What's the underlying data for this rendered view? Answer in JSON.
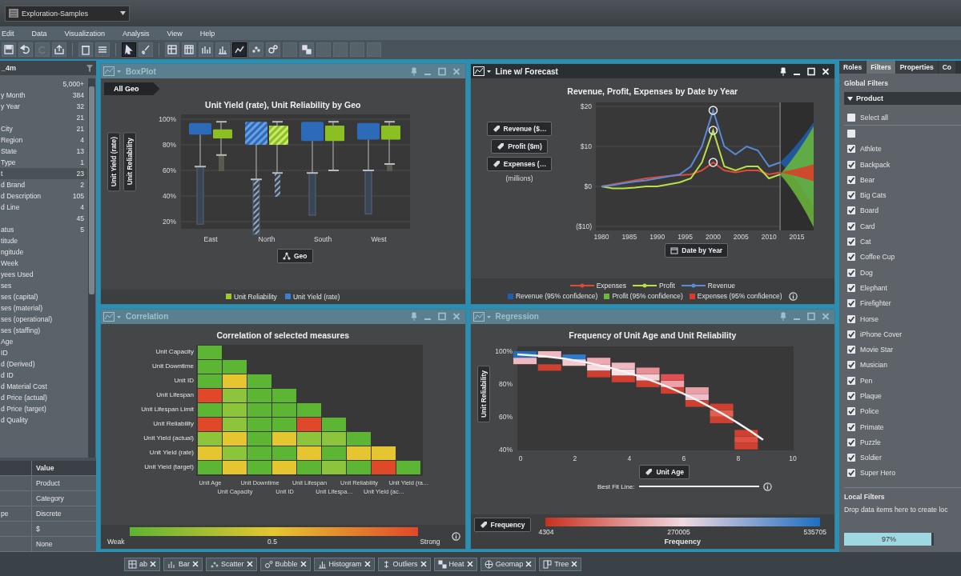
{
  "title_bar": {
    "document": "Exploration-Samples"
  },
  "menu": [
    "Edit",
    "Data",
    "Visualization",
    "Analysis",
    "View",
    "Help"
  ],
  "toolbar": [
    {
      "kind": "save",
      "selected": false
    },
    {
      "kind": "undo",
      "selected": false
    },
    {
      "kind": "redo",
      "selected": false
    },
    {
      "kind": "export",
      "selected": false
    },
    {
      "kind": "delete",
      "selected": false
    },
    {
      "kind": "layers",
      "selected": false
    },
    {
      "kind": "pointer",
      "selected": true
    },
    {
      "kind": "brush",
      "selected": false
    },
    {
      "kind": "crosstab",
      "selected": false
    },
    {
      "kind": "table",
      "selected": false
    },
    {
      "kind": "bars",
      "selected": false
    },
    {
      "kind": "columns",
      "selected": false
    },
    {
      "kind": "line",
      "selected": true
    },
    {
      "kind": "scatter",
      "selected": false
    },
    {
      "kind": "bubble",
      "selected": false
    },
    {
      "kind": "blank",
      "selected": false
    },
    {
      "kind": "heat",
      "selected": false
    },
    {
      "kind": "blank",
      "selected": false
    },
    {
      "kind": "blank",
      "selected": false
    },
    {
      "kind": "blank",
      "selected": false
    },
    {
      "kind": "blank",
      "selected": false
    }
  ],
  "data_panel": {
    "title": "_4m",
    "items": [
      {
        "count": "5,000+",
        "selected": false
      },
      {
        "name": "y Month",
        "count": "384",
        "selected": false
      },
      {
        "name": "y Year",
        "count": "32",
        "selected": false
      },
      {
        "count": "21",
        "selected": false
      },
      {
        "name": "City",
        "count": "21",
        "selected": false
      },
      {
        "name": "Region",
        "count": "4",
        "selected": false
      },
      {
        "name": "State",
        "count": "13",
        "selected": false
      },
      {
        "name": "Type",
        "count": "1",
        "selected": false
      },
      {
        "name": "t",
        "count": "23",
        "selected": true
      },
      {
        "name": "d Brand",
        "count": "2",
        "selected": false
      },
      {
        "name": "d Description",
        "count": "105",
        "selected": false
      },
      {
        "name": "d Line",
        "count": "4",
        "selected": false
      },
      {
        "count": "45",
        "selected": false
      },
      {
        "name": "atus",
        "count": "5",
        "selected": false
      },
      {
        "name": "titude",
        "selected": false
      },
      {
        "name": "ngitude",
        "selected": false
      },
      {
        "name": "Week",
        "selected": false
      },
      {
        "name": "yees Used",
        "selected": false
      },
      {
        "name": "ses",
        "selected": false
      },
      {
        "name": "ses (capital)",
        "selected": false
      },
      {
        "name": "ses (material)",
        "selected": false
      },
      {
        "name": "ses (operational)",
        "selected": false
      },
      {
        "name": "ses (staffing)",
        "selected": false
      },
      {
        "name": "Age",
        "selected": false
      },
      {
        "name": "ID",
        "selected": false
      },
      {
        "name": "d (Derived)",
        "selected": false
      },
      {
        "name": "d ID",
        "selected": false
      },
      {
        "name": "d Material Cost",
        "selected": false
      },
      {
        "name": "d Price (actual)",
        "selected": false
      },
      {
        "name": "d Price (target)",
        "selected": false
      },
      {
        "name": "d Quality",
        "selected": false
      }
    ],
    "properties": {
      "value_header": "Value",
      "rows": [
        {
          "value": "Product"
        },
        {
          "value": "Category"
        },
        {
          "name": "pe",
          "value": "Discrete"
        },
        {
          "value": "$"
        },
        {
          "value": "None"
        }
      ]
    }
  },
  "boxplot_panel": {
    "title": "BoxPlot",
    "active": false,
    "breadcrumb": "All Geo",
    "chart_title": "Unit Yield (rate), Unit Reliability by Geo",
    "y_ticks": [
      "100%",
      "80%",
      "60%",
      "40%",
      "20%"
    ],
    "roles": [
      "Unit Yield (rate)",
      "Unit Reliability"
    ],
    "categories": [
      {
        "label": "East",
        "selected": false
      },
      {
        "label": "North",
        "selected": true
      },
      {
        "label": "South",
        "selected": false
      },
      {
        "label": "West",
        "selected": false
      }
    ],
    "x_role": "Geo",
    "legend": [
      {
        "label": "Unit Reliability",
        "color": "#9ccc2c"
      },
      {
        "label": "Unit Yield (rate)",
        "color": "#3a7fd0"
      }
    ]
  },
  "line_panel": {
    "title": "Line w/ Forecast",
    "active": true,
    "roles": [
      "Revenue ($…",
      "Profit ($m)",
      "Expenses (…"
    ],
    "unit_note": "(millions)",
    "x_role": "Date by Year",
    "chart_data": {
      "type": "line",
      "title": "Revenue, Profit, Expenses by Date by Year",
      "x": [
        1980,
        1982,
        1984,
        1986,
        1988,
        1990,
        1992,
        1994,
        1996,
        1998,
        2000,
        2002,
        2004,
        2006,
        2008,
        2010,
        2012
      ],
      "series": [
        {
          "name": "Expenses",
          "color": "#e04a3a",
          "values": [
            0,
            0.5,
            1,
            1.5,
            2,
            2.3,
            2.6,
            2.8,
            3,
            4,
            6,
            4,
            3.5,
            4,
            4,
            3,
            3.5
          ]
        },
        {
          "name": "Profit",
          "color": "#b8e04a",
          "values": [
            0,
            -0.5,
            -0.5,
            -0.3,
            0,
            0,
            0.5,
            1,
            2,
            6,
            14,
            5,
            4,
            5,
            5,
            2,
            3
          ]
        },
        {
          "name": "Revenue",
          "color": "#5a8ad8",
          "values": [
            0,
            0.3,
            0.8,
            1.2,
            1.5,
            2,
            2.5,
            3,
            5,
            10,
            19,
            10,
            8,
            10,
            9,
            5,
            6
          ]
        }
      ],
      "xlim": [
        1979,
        2018
      ],
      "ylim": [
        -11,
        21
      ],
      "grid": true,
      "ref_lines": [
        {
          "axis": "x",
          "value": 2012
        }
      ],
      "xticks": [
        1980,
        1985,
        1990,
        1995,
        2000,
        2005,
        2010,
        2015
      ],
      "yticks": [
        {
          "value": 20,
          "label": "$20"
        },
        {
          "value": 10,
          "label": "$10"
        },
        {
          "value": 0,
          "label": "$0"
        },
        {
          "value": -10,
          "label": "($10)"
        }
      ]
    },
    "confidence_legend": [
      {
        "label": "Revenue (95% confidence)",
        "color": "#1f5fb0"
      },
      {
        "label": "Profit (95% confidence)",
        "color": "#6cb83a"
      },
      {
        "label": "Expenses (95% confidence)",
        "color": "#e03a2a"
      }
    ]
  },
  "correlation_panel": {
    "title": "Correlation",
    "active": false,
    "chart_title": "Correlation of selected measures",
    "rows": [
      "Unit Capacity",
      "Unit Downtime",
      "Unit ID",
      "Unit Lifespan",
      "Unit Lifespan Limit",
      "Unit Reliability",
      "Unit Yield (actual)",
      "Unit Yield (rate)",
      "Unit Yield (target)"
    ],
    "columns": [
      "Unit Age",
      "Unit Capacity",
      "Unit Downtime",
      "Unit ID",
      "Unit Lifespan",
      "Unit Lifespa…",
      "Unit Reliability",
      "Unit Yield (ac…",
      "Unit Yield (ra…"
    ],
    "legend": {
      "low": "Weak",
      "mid": "0.5",
      "high": "Strong"
    }
  },
  "regression_panel": {
    "title": "Regression",
    "active": false,
    "chart_title": "Frequency of Unit Age and Unit Reliability",
    "y_role": "Unit Reliability",
    "y_ticks": [
      "100%",
      "80%",
      "60%",
      "40%"
    ],
    "x_ticks": [
      "0",
      "2",
      "4",
      "6",
      "8",
      "10"
    ],
    "x_role": "Unit Age",
    "best_fit_label": "Best Fit Line:",
    "color_role": "Frequency",
    "scale": {
      "low": "4304",
      "mid": "270005",
      "high": "535705",
      "title": "Frequency"
    }
  },
  "right_panel": {
    "tabs": [
      {
        "label": "Roles",
        "selected": false
      },
      {
        "label": "Filters",
        "selected": true
      },
      {
        "label": "Properties",
        "selected": false
      },
      {
        "label": "Co",
        "selected": false
      }
    ],
    "global_filters": "Global Filters",
    "filter": {
      "label": "Product",
      "expanded": true
    },
    "select_all": {
      "label": "Select all",
      "checked": false
    },
    "values": [
      {
        "checked": false
      },
      {
        "label": "Athlete",
        "checked": true
      },
      {
        "label": "Backpack",
        "checked": true
      },
      {
        "label": "Bear",
        "checked": true
      },
      {
        "label": "Big Cats",
        "checked": true
      },
      {
        "label": "Board",
        "checked": true
      },
      {
        "label": "Card",
        "checked": true
      },
      {
        "label": "Cat",
        "checked": true
      },
      {
        "label": "Coffee Cup",
        "checked": true
      },
      {
        "label": "Dog",
        "checked": true
      },
      {
        "label": "Elephant",
        "checked": true
      },
      {
        "label": "Firefighter",
        "checked": true
      },
      {
        "label": "Horse",
        "checked": true
      },
      {
        "label": "iPhone Cover",
        "checked": true
      },
      {
        "label": "Movie Star",
        "checked": true
      },
      {
        "label": "Musician",
        "checked": true
      },
      {
        "label": "Pen",
        "checked": true
      },
      {
        "label": "Plaque",
        "checked": true
      },
      {
        "label": "Police",
        "checked": true
      },
      {
        "label": "Primate",
        "checked": true
      },
      {
        "label": "Puzzle",
        "checked": true
      },
      {
        "label": "Soldier",
        "checked": true
      },
      {
        "label": "Super Hero",
        "checked": true
      }
    ],
    "local_filters": "Local Filters",
    "drop_hint": "Drop data items here to create loc",
    "progress": {
      "label": "97%",
      "level": 0.97
    }
  },
  "bottom_tabs": [
    {
      "kind": "crosstab",
      "label": "ab"
    },
    {
      "kind": "bar",
      "label": "Bar"
    },
    {
      "kind": "scatter",
      "label": "Scatter"
    },
    {
      "kind": "bubble",
      "label": "Bubble"
    },
    {
      "kind": "histogram",
      "label": "Histogram"
    },
    {
      "kind": "outliers",
      "label": "Outliers"
    },
    {
      "kind": "heat",
      "label": "Heat"
    },
    {
      "kind": "geomap",
      "label": "Geomap"
    },
    {
      "kind": "tree",
      "label": "Tree"
    }
  ]
}
